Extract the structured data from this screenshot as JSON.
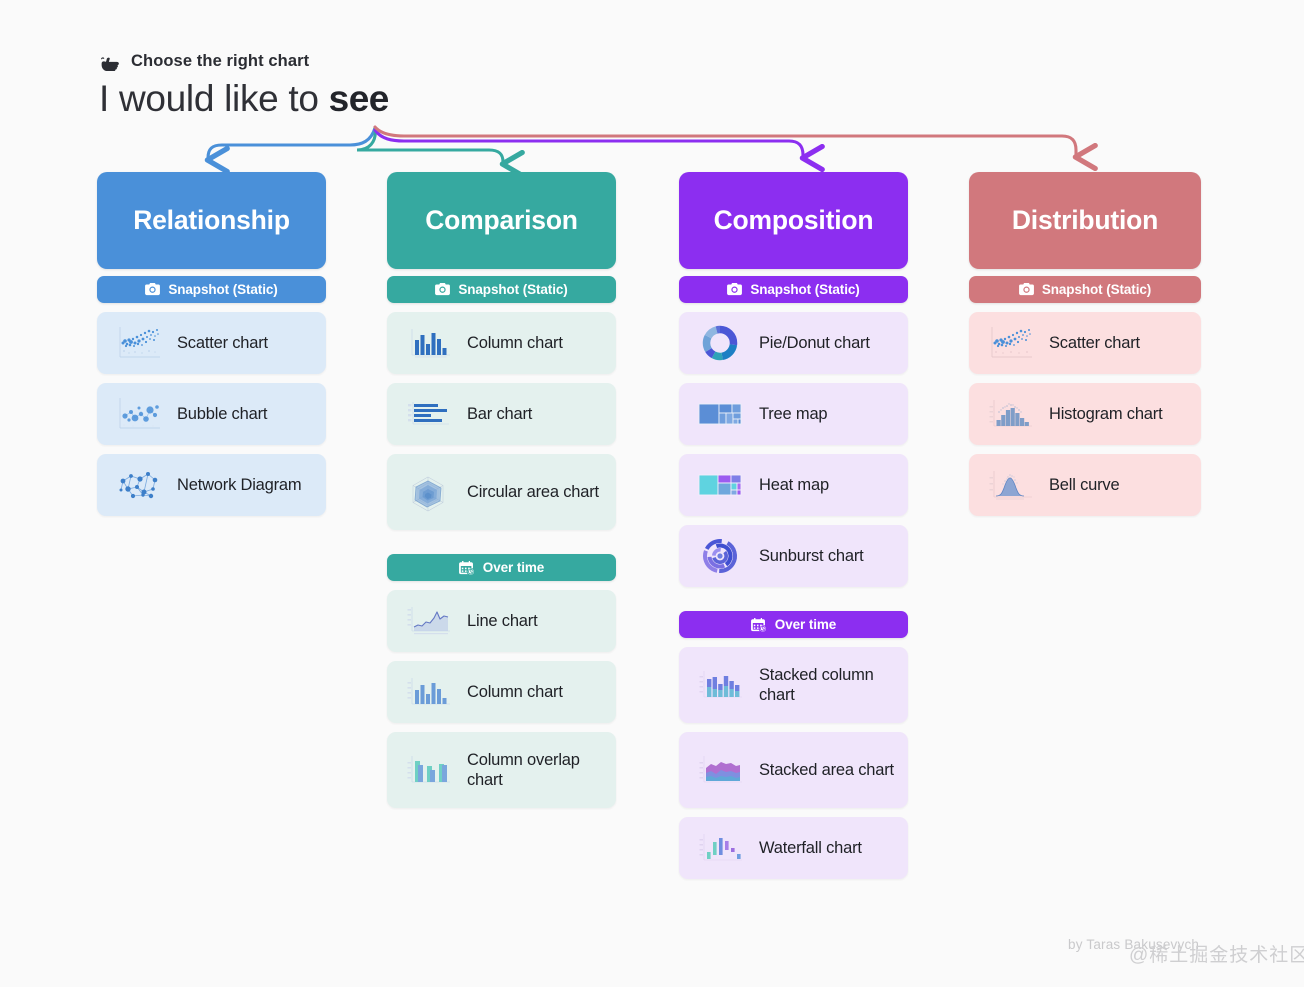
{
  "header": {
    "kicker": "Choose the right chart",
    "hand_icon": "pointing-hand-icon",
    "headline_prefix": "I would like to ",
    "headline_emphasis": "see"
  },
  "badges": {
    "snapshot_label": "Snapshot (Static)",
    "snapshot_icon": "camera-icon",
    "over_time_label": "Over time",
    "over_time_icon": "calendar-clock-icon"
  },
  "colors": {
    "background": "#fafafa",
    "relationship": "#4a90d9",
    "relationship_card": "#dceaf8",
    "comparison": "#36a9a0",
    "comparison_card": "#e4f1ee",
    "composition": "#8c2ef0",
    "composition_card": "#f0e5fb",
    "distribution": "#d1787d",
    "distribution_card": "#fcdfe0",
    "headline_text": "#2f3036"
  },
  "columns": [
    {
      "id": "relationship",
      "title": "Relationship",
      "groups": [
        {
          "badge": "snapshot",
          "items": [
            {
              "label": "Scatter chart",
              "icon": "scatter-chart-icon"
            },
            {
              "label": "Bubble chart",
              "icon": "bubble-chart-icon"
            },
            {
              "label": "Network Diagram",
              "icon": "network-diagram-icon"
            }
          ]
        }
      ]
    },
    {
      "id": "comparison",
      "title": "Comparison",
      "groups": [
        {
          "badge": "snapshot",
          "items": [
            {
              "label": "Column chart",
              "icon": "column-chart-icon"
            },
            {
              "label": "Bar chart",
              "icon": "bar-chart-icon"
            },
            {
              "label": "Circular area chart",
              "icon": "radar-chart-icon"
            }
          ]
        },
        {
          "badge": "over_time",
          "items": [
            {
              "label": "Line chart",
              "icon": "line-chart-icon"
            },
            {
              "label": "Column chart",
              "icon": "column-chart-icon"
            },
            {
              "label": "Column overlap chart",
              "icon": "column-overlap-chart-icon"
            }
          ]
        }
      ]
    },
    {
      "id": "composition",
      "title": "Composition",
      "groups": [
        {
          "badge": "snapshot",
          "items": [
            {
              "label": "Pie/Donut chart",
              "icon": "donut-chart-icon"
            },
            {
              "label": "Tree map",
              "icon": "tree-map-icon"
            },
            {
              "label": "Heat map",
              "icon": "heat-map-icon"
            },
            {
              "label": "Sunburst chart",
              "icon": "sunburst-chart-icon"
            }
          ]
        },
        {
          "badge": "over_time",
          "items": [
            {
              "label": "Stacked column chart",
              "icon": "stacked-column-chart-icon"
            },
            {
              "label": "Stacked area chart",
              "icon": "stacked-area-chart-icon"
            },
            {
              "label": "Waterfall chart",
              "icon": "waterfall-chart-icon"
            }
          ]
        }
      ]
    },
    {
      "id": "distribution",
      "title": "Distribution",
      "groups": [
        {
          "badge": "snapshot",
          "items": [
            {
              "label": "Scatter chart",
              "icon": "scatter-chart-icon"
            },
            {
              "label": "Histogram chart",
              "icon": "histogram-chart-icon"
            },
            {
              "label": "Bell curve",
              "icon": "bell-curve-icon"
            }
          ]
        }
      ]
    }
  ],
  "footer": {
    "credit": "by Taras Bakusevych",
    "watermark": "@稀土掘金技术社区"
  }
}
